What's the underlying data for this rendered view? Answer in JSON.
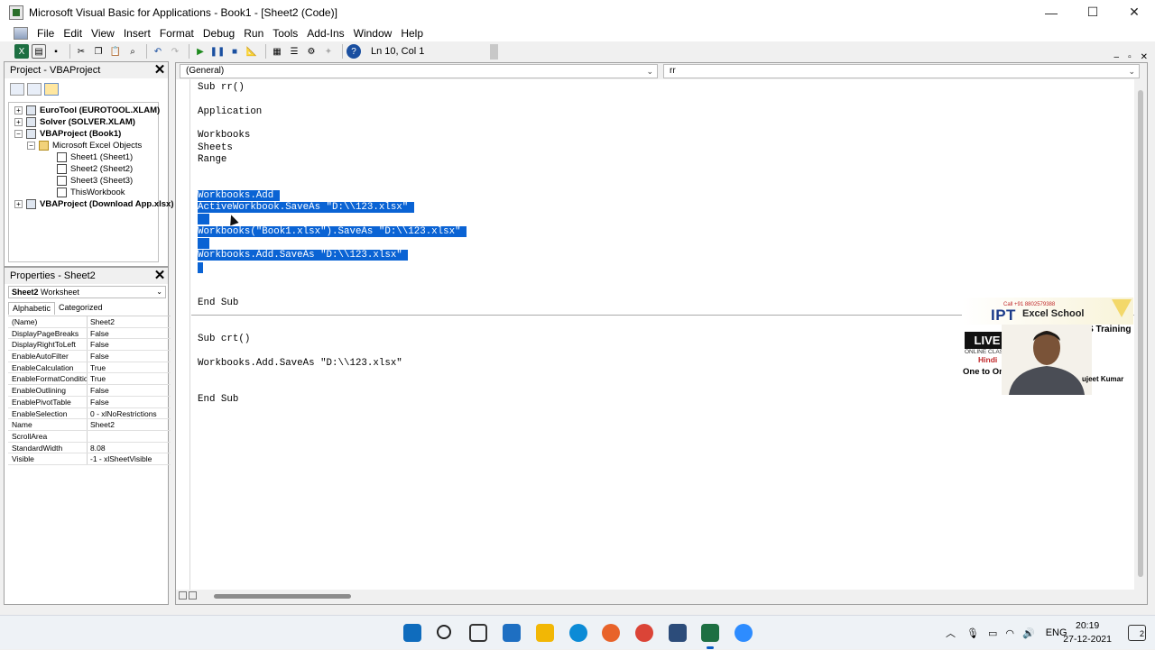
{
  "window": {
    "title": "Microsoft Visual Basic for Applications - Book1 - [Sheet2 (Code)]",
    "controls": [
      "—",
      "☐",
      "✕"
    ],
    "mdi_controls": [
      "–",
      "▫",
      "✕"
    ]
  },
  "menu": [
    "File",
    "Edit",
    "View",
    "Insert",
    "Format",
    "Debug",
    "Run",
    "Tools",
    "Add-Ins",
    "Window",
    "Help"
  ],
  "toolbar": {
    "icons": [
      "excel-icon",
      "insert-module-icon",
      "save-icon",
      "cut-icon",
      "copy-icon",
      "paste-icon",
      "find-icon",
      "undo-icon",
      "redo-icon",
      "run-icon",
      "break-icon",
      "reset-icon",
      "design-mode-icon",
      "project-explorer-icon",
      "properties-icon",
      "object-browser-icon",
      "toolbox-icon",
      "help-icon"
    ],
    "status": "Ln 10, Col 1"
  },
  "project": {
    "title": "Project - VBAProject",
    "close": "✕",
    "tree": [
      {
        "label": "EuroTool (EUROTOOL.XLAM)",
        "level": 0,
        "bold": true,
        "expander": "+"
      },
      {
        "label": "Solver (SOLVER.XLAM)",
        "level": 0,
        "bold": true,
        "expander": "+"
      },
      {
        "label": "VBAProject (Book1)",
        "level": 0,
        "bold": true,
        "expander": "−"
      },
      {
        "label": "Microsoft Excel Objects",
        "level": 1,
        "bold": false,
        "expander": "−"
      },
      {
        "label": "Sheet1 (Sheet1)",
        "level": 2,
        "bold": false,
        "expander": ""
      },
      {
        "label": "Sheet2 (Sheet2)",
        "level": 2,
        "bold": false,
        "expander": ""
      },
      {
        "label": "Sheet3 (Sheet3)",
        "level": 2,
        "bold": false,
        "expander": ""
      },
      {
        "label": "ThisWorkbook",
        "level": 2,
        "bold": false,
        "expander": ""
      },
      {
        "label": "VBAProject (Download App.xlsx)",
        "level": 0,
        "bold": true,
        "expander": "+"
      }
    ]
  },
  "properties": {
    "title": "Properties - Sheet2",
    "close": "✕",
    "object_name": "Sheet2",
    "object_type": "Worksheet",
    "tabs": [
      "Alphabetic",
      "Categorized"
    ],
    "rows": [
      {
        "k": "(Name)",
        "v": "Sheet2"
      },
      {
        "k": "DisplayPageBreaks",
        "v": "False"
      },
      {
        "k": "DisplayRightToLeft",
        "v": "False"
      },
      {
        "k": "EnableAutoFilter",
        "v": "False"
      },
      {
        "k": "EnableCalculation",
        "v": "True"
      },
      {
        "k": "EnableFormatConditions",
        "v": "True"
      },
      {
        "k": "EnableOutlining",
        "v": "False"
      },
      {
        "k": "EnablePivotTable",
        "v": "False"
      },
      {
        "k": "EnableSelection",
        "v": "0 - xlNoRestrictions"
      },
      {
        "k": "Name",
        "v": "Sheet2"
      },
      {
        "k": "ScrollArea",
        "v": ""
      },
      {
        "k": "StandardWidth",
        "v": "8.08"
      },
      {
        "k": "Visible",
        "v": "-1 - xlSheetVisible"
      }
    ]
  },
  "code": {
    "object_combo": "(General)",
    "proc_combo": "rr",
    "lines": [
      {
        "text": "Sub rr()",
        "selected": false
      },
      {
        "text": "",
        "selected": false
      },
      {
        "text": "Application",
        "selected": false
      },
      {
        "text": "",
        "selected": false
      },
      {
        "text": "Workbooks",
        "selected": false
      },
      {
        "text": "Sheets",
        "selected": false
      },
      {
        "text": "Range",
        "selected": false
      },
      {
        "text": "",
        "selected": false
      },
      {
        "text": "",
        "selected": false
      },
      {
        "text": "Workbooks.Add ",
        "selected": true
      },
      {
        "text": "ActiveWorkbook.SaveAs \"D:\\\\123.xlsx\" ",
        "selected": true
      },
      {
        "text": "  ",
        "selected": true
      },
      {
        "text": "Workbooks(\"Book1.xlsx\").SaveAs \"D:\\\\123.xlsx\" ",
        "selected": true
      },
      {
        "text": "  ",
        "selected": true
      },
      {
        "text": "Workbooks.Add.SaveAs \"D:\\\\123.xlsx\" ",
        "selected": true
      },
      {
        "text": " ",
        "selected": true
      },
      {
        "text": "",
        "selected": false
      },
      {
        "text": "",
        "selected": false
      },
      {
        "text": "End Sub",
        "selected": false
      },
      {
        "text": "",
        "selected": false
      },
      {
        "text": "",
        "selected": false
      },
      {
        "text": "Sub crt()",
        "selected": false
      },
      {
        "text": "",
        "selected": false
      },
      {
        "text": "Workbooks.Add.SaveAs \"D:\\\\123.xlsx\"",
        "selected": false
      },
      {
        "text": "",
        "selected": false
      },
      {
        "text": "",
        "selected": false
      },
      {
        "text": "End Sub",
        "selected": false
      }
    ]
  },
  "overlay": {
    "call": "Call +91 8802579388",
    "logo": "IPT",
    "school": "Excel School",
    "mis": "MIS Training",
    "live": "LIVE",
    "online": "ONLINE CLASSES",
    "hindi": "Hindi",
    "one": "One to One",
    "name": "ujeet Kumar"
  },
  "taskbar": {
    "apps": [
      "windows-start-icon",
      "search-icon",
      "task-view-icon",
      "widgets-icon",
      "file-explorer-icon",
      "edge-icon",
      "firefox-icon",
      "chrome-icon",
      "global-icon",
      "excel-icon",
      "zoom-icon"
    ],
    "colors": [
      "#0f6cbd",
      "#222222",
      "#333333",
      "#1e6fc2",
      "#f2b705",
      "#0c8bd6",
      "#e8632a",
      "#db4437",
      "#2c4c7a",
      "#1d6f42",
      "#2d8cff"
    ],
    "tray_lang": "ENG",
    "time": "20:19",
    "date": "27-12-2021",
    "notifications": "2"
  },
  "colors": {
    "selection": "#0a63d4"
  }
}
